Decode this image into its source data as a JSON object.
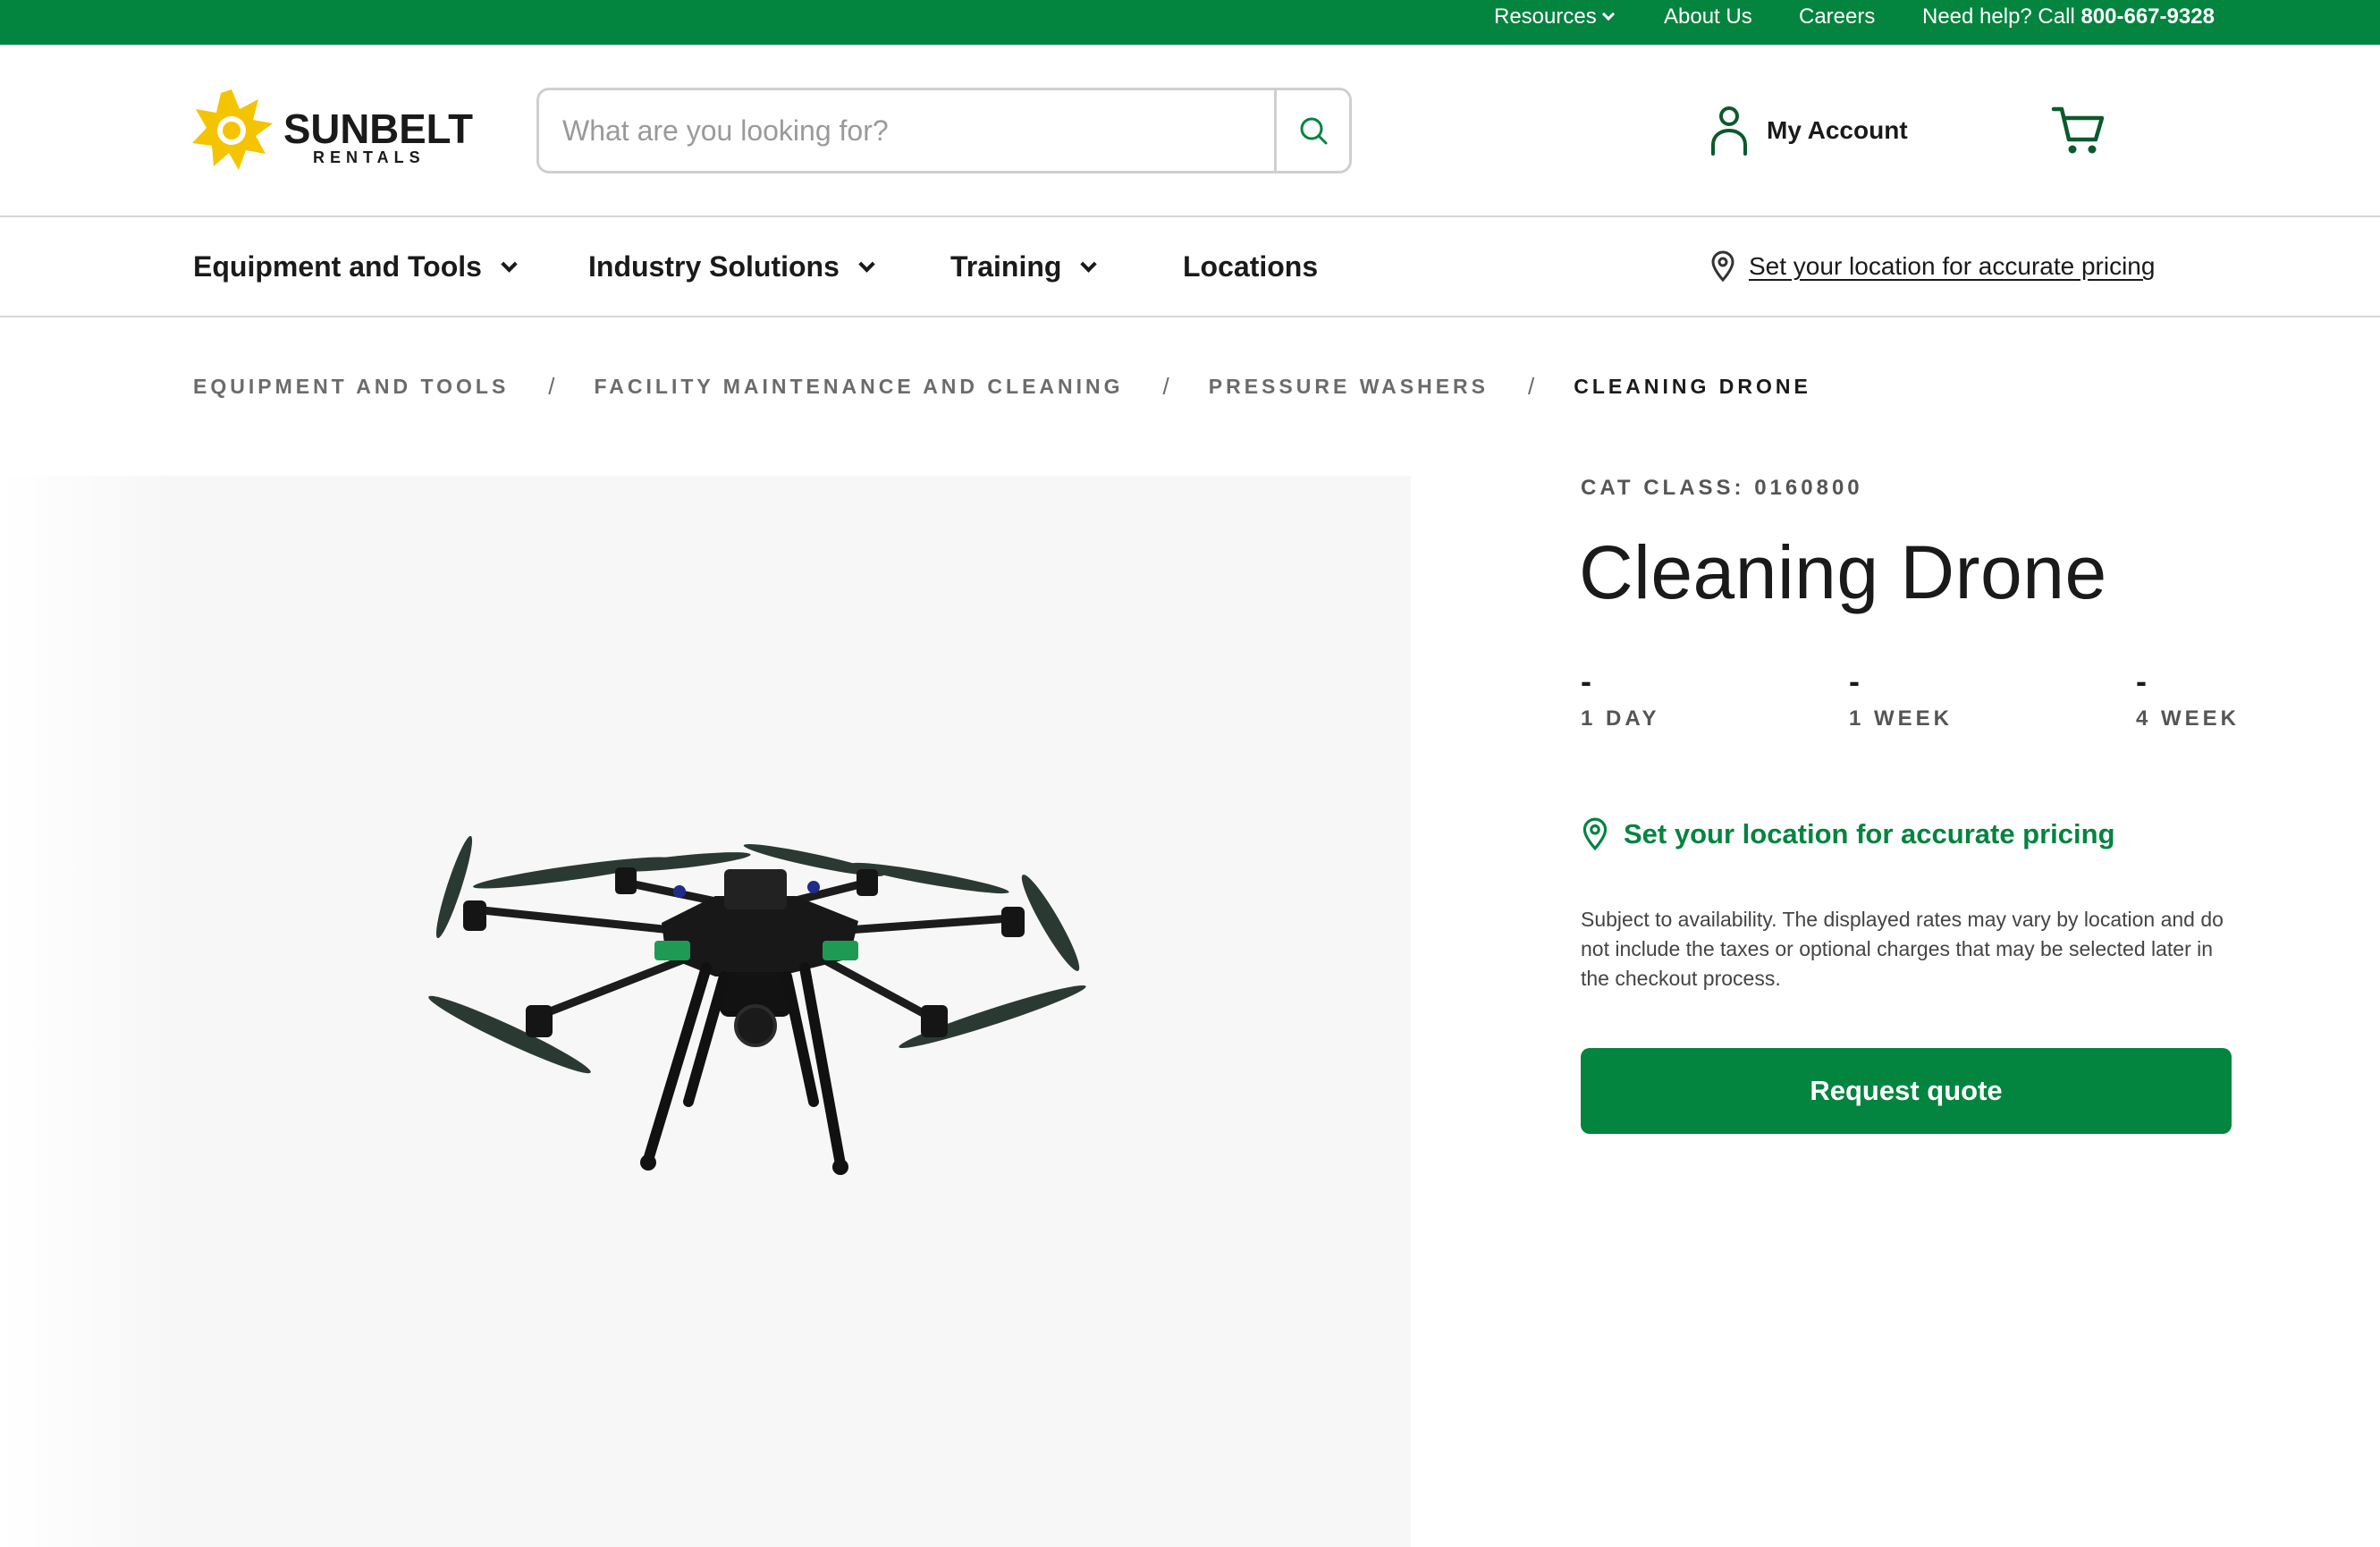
{
  "utility_bar": {
    "resources": "Resources",
    "about": "About Us",
    "careers": "Careers",
    "help_prefix": "Need help? Call",
    "help_phone": "800-667-9328"
  },
  "header": {
    "logo_text": "SUNBELT",
    "logo_subtext": "RENTALS",
    "search_placeholder": "What are you looking for?",
    "account_label": "My Account"
  },
  "nav": {
    "items": [
      {
        "label": "Equipment and Tools"
      },
      {
        "label": "Industry Solutions"
      },
      {
        "label": "Training"
      },
      {
        "label": "Locations"
      }
    ],
    "location_label": "Set your location for accurate pricing"
  },
  "breadcrumb": [
    "EQUIPMENT AND TOOLS",
    "FACILITY MAINTENANCE AND CLEANING",
    "PRESSURE WASHERS",
    "CLEANING DRONE"
  ],
  "breadcrumb_separator": "/",
  "product": {
    "cat_class": "CAT CLASS: 0160800",
    "title": "Cleaning Drone",
    "rates": [
      {
        "value": "-",
        "label": "1 DAY"
      },
      {
        "value": "-",
        "label": "1 WEEK"
      },
      {
        "value": "-",
        "label": "4 WEEK"
      }
    ],
    "location_cta": "Set your location for accurate pricing",
    "disclaimer": "Subject to availability. The displayed rates may vary by location and do not include the taxes or optional charges that may be selected later in the checkout process.",
    "quote_button": "Request quote"
  },
  "icons": {
    "search": "search-icon",
    "account": "user-icon",
    "cart": "cart-icon",
    "location": "map-pin-icon",
    "dropdown": "chevron-down-icon"
  },
  "colors": {
    "brand_green": "#03843f",
    "logo_yellow": "#f5c400",
    "text_dark": "#1a1a1a",
    "text_muted": "#6b6b6b"
  }
}
